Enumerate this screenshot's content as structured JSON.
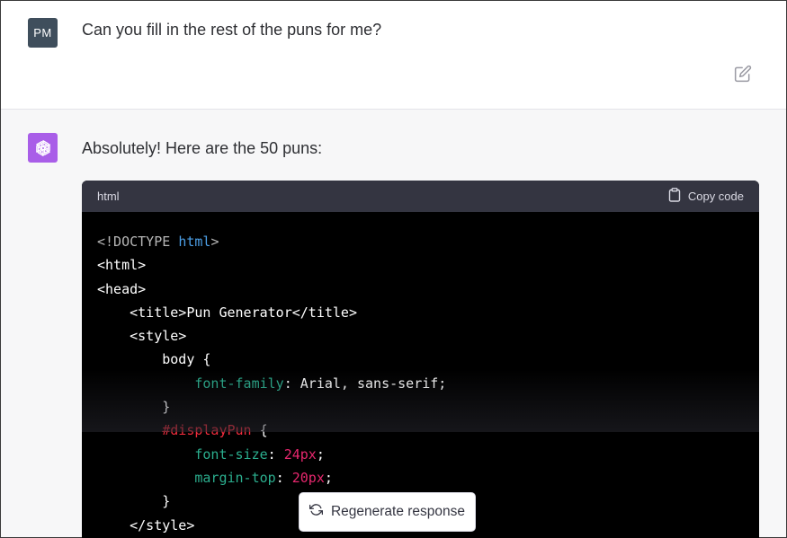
{
  "user": {
    "avatar_initials": "PM",
    "message": "Can you fill in the rest of the puns for me?",
    "edit_icon": "pencil-square-icon"
  },
  "assistant": {
    "avatar_icon": "openai-logo-icon",
    "message": "Absolutely! Here are the 50 puns:",
    "code": {
      "language": "html",
      "copy_label": "Copy code",
      "lines": [
        [
          {
            "t": "<!DOCTYPE ",
            "c": "gray"
          },
          {
            "t": "html",
            "c": "blue"
          },
          {
            "t": ">",
            "c": "gray"
          }
        ],
        [
          {
            "t": "<html>",
            "c": "white"
          }
        ],
        [
          {
            "t": "<head>",
            "c": "white"
          }
        ],
        [
          {
            "t": "    <title>Pun Generator</title>",
            "c": "white"
          }
        ],
        [
          {
            "t": "    <style>",
            "c": "white"
          }
        ],
        [
          {
            "t": "        body {",
            "c": "white"
          }
        ],
        [
          {
            "t": "            ",
            "c": "white"
          },
          {
            "t": "font-family",
            "c": "green"
          },
          {
            "t": ": Arial, sans-serif;",
            "c": "white"
          }
        ],
        [
          {
            "t": "        }",
            "c": "white"
          }
        ],
        [
          {
            "t": "        ",
            "c": "white"
          },
          {
            "t": "#displayPun",
            "c": "red"
          },
          {
            "t": " {",
            "c": "white"
          }
        ],
        [
          {
            "t": "            ",
            "c": "white"
          },
          {
            "t": "font-size",
            "c": "green"
          },
          {
            "t": ": ",
            "c": "white"
          },
          {
            "t": "24px",
            "c": "pink"
          },
          {
            "t": ";",
            "c": "white"
          }
        ],
        [
          {
            "t": "            ",
            "c": "white"
          },
          {
            "t": "margin-top",
            "c": "green"
          },
          {
            "t": ": ",
            "c": "white"
          },
          {
            "t": "20px",
            "c": "pink"
          },
          {
            "t": ";",
            "c": "white"
          }
        ],
        [
          {
            "t": "        }",
            "c": "white"
          }
        ],
        [
          {
            "t": "    </style>",
            "c": "white"
          }
        ]
      ]
    }
  },
  "regenerate": {
    "label": "Regenerate response",
    "icon": "refresh-icon"
  },
  "colors": {
    "user_avatar": "#3f4e5c",
    "bot_avatar": "#a95ee8",
    "code_header": "#343541",
    "code_bg": "#000000"
  }
}
